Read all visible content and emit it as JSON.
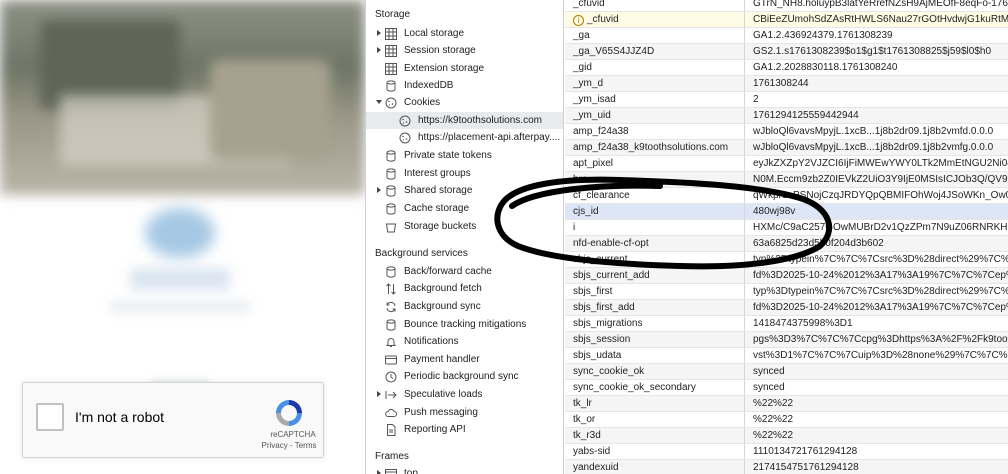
{
  "page": {
    "recaptcha": {
      "label": "I'm not a robot",
      "brand": "reCAPTCHA",
      "links": "Privacy - Terms"
    }
  },
  "devtools": {
    "sidebar": {
      "storage_title": "Storage",
      "storage_items": [
        {
          "label": "Local storage",
          "icon": "table-icon",
          "expandable": true
        },
        {
          "label": "Session storage",
          "icon": "table-icon",
          "expandable": true
        },
        {
          "label": "Extension storage",
          "icon": "table-icon",
          "expandable": false
        },
        {
          "label": "IndexedDB",
          "icon": "database-icon",
          "expandable": false
        },
        {
          "label": "Cookies",
          "icon": "cookie-icon",
          "expanded": true
        },
        {
          "label": "https://k9toothsolutions.com",
          "icon": "cookie-icon",
          "selected": true
        },
        {
          "label": "https://placement-api.afterpay....",
          "icon": "cookie-icon"
        },
        {
          "label": "Private state tokens",
          "icon": "database-icon"
        },
        {
          "label": "Interest groups",
          "icon": "database-icon"
        },
        {
          "label": "Shared storage",
          "icon": "database-icon",
          "expandable": true
        },
        {
          "label": "Cache storage",
          "icon": "database-icon"
        },
        {
          "label": "Storage buckets",
          "icon": "bucket-icon"
        }
      ],
      "background_title": "Background services",
      "background_items": [
        {
          "label": "Back/forward cache",
          "icon": "database-icon"
        },
        {
          "label": "Background fetch",
          "icon": "updown-arrows-icon"
        },
        {
          "label": "Background sync",
          "icon": "sync-icon"
        },
        {
          "label": "Bounce tracking mitigations",
          "icon": "database-icon"
        },
        {
          "label": "Notifications",
          "icon": "bell-icon"
        },
        {
          "label": "Payment handler",
          "icon": "card-icon"
        },
        {
          "label": "Periodic background sync",
          "icon": "clock-icon"
        },
        {
          "label": "Speculative loads",
          "icon": "arrow-right-icon",
          "expandable": true
        },
        {
          "label": "Push messaging",
          "icon": "cloud-icon"
        },
        {
          "label": "Reporting API",
          "icon": "document-icon"
        }
      ],
      "frames_title": "Frames",
      "frames_item": "top"
    },
    "cookies": [
      {
        "name": "_cfuvid",
        "value": "GTrN_NH8.holuypB3latYeRrefNZsH9AjMEOfF8eqFo-1761..."
      },
      {
        "name": "_cfuvid",
        "value": "CBiEeZUmohSdZAsRtHWLS6Nau27rGOtHvdwjG1kuRtM-...",
        "warning": true
      },
      {
        "name": "_ga",
        "value": "GA1.2.436924379.1761308239"
      },
      {
        "name": "_ga_V65S4JJZ4D",
        "value": "GS2.1.s1761308239$o1$g1$t1761308825$j59$l0$h0"
      },
      {
        "name": "_gid",
        "value": "GA1.2.2028830118.1761308240"
      },
      {
        "name": "_ym_d",
        "value": "1761308244"
      },
      {
        "name": "_ym_isad",
        "value": "2"
      },
      {
        "name": "_ym_uid",
        "value": "1761294125559442944"
      },
      {
        "name": "amp_f24a38",
        "value": "wJbloQl6vavsMpyjL.1xcB...1j8b2dr09.1j8b2vmfd.0.0.0"
      },
      {
        "name": "amp_f24a38_k9toothsolutions.com",
        "value": "wJbloQl6vavsMpyjL.1xcB...1j8b2dr09.1j8b2vmfg.0.0.0"
      },
      {
        "name": "apt_pixel",
        "value": "eyJkZXZpY2VJZCI6IjFiMWEwYWY0LTk2MmEtNGU2Ni04..."
      },
      {
        "name": "bm",
        "value": "N0M.Eccm9zb2Z0IEVkZ2UiO3Y9IjE0MSIsICJOb3Q/QV9C..."
      },
      {
        "name": "cf_clearance",
        "value": "qWkpr1ePSNojCzqJRDYQpQBMIFOhWoj4JSoWKn_Ow0..."
      },
      {
        "name": "cjs_id",
        "value": "480wj98v",
        "selected": true
      },
      {
        "name": "i",
        "value": "HXMc/C9aC257GOwMUBrD2v1QzZPm7N9uZ06RNRKH..."
      },
      {
        "name": "nfd-enable-cf-opt",
        "value": "63a6825d23d5b0f204d3b602"
      },
      {
        "name": "sbjs_current",
        "value": "typ%3Dtypein%7C%7C%7Csrc%3D%28direct%29%7C%7..."
      },
      {
        "name": "sbjs_current_add",
        "value": "fd%3D2025-10-24%2012%3A17%3A19%7C%7C%7Cep%..."
      },
      {
        "name": "sbjs_first",
        "value": "typ%3Dtypein%7C%7C%7Csrc%3D%28direct%29%7C%7..."
      },
      {
        "name": "sbjs_first_add",
        "value": "fd%3D2025-10-24%2012%3A17%3A19%7C%7C%7Cep%..."
      },
      {
        "name": "sbjs_migrations",
        "value": "1418474375998%3D1"
      },
      {
        "name": "sbjs_session",
        "value": "pgs%3D3%7C%7C%7Ccpg%3Dhttps%3A%2F%2Fk9toot..."
      },
      {
        "name": "sbjs_udata",
        "value": "vst%3D1%7C%7C%7Cuip%3D%28none%29%7C%7C%7Cu..."
      },
      {
        "name": "sync_cookie_ok",
        "value": "synced"
      },
      {
        "name": "sync_cookie_ok_secondary",
        "value": "synced"
      },
      {
        "name": "tk_lr",
        "value": "%22%22"
      },
      {
        "name": "tk_or",
        "value": "%22%22"
      },
      {
        "name": "tk_r3d",
        "value": "%22%22"
      },
      {
        "name": "yabs-sid",
        "value": "1110134721761294128"
      },
      {
        "name": "yandexuid",
        "value": "2174154751761294128"
      }
    ]
  }
}
